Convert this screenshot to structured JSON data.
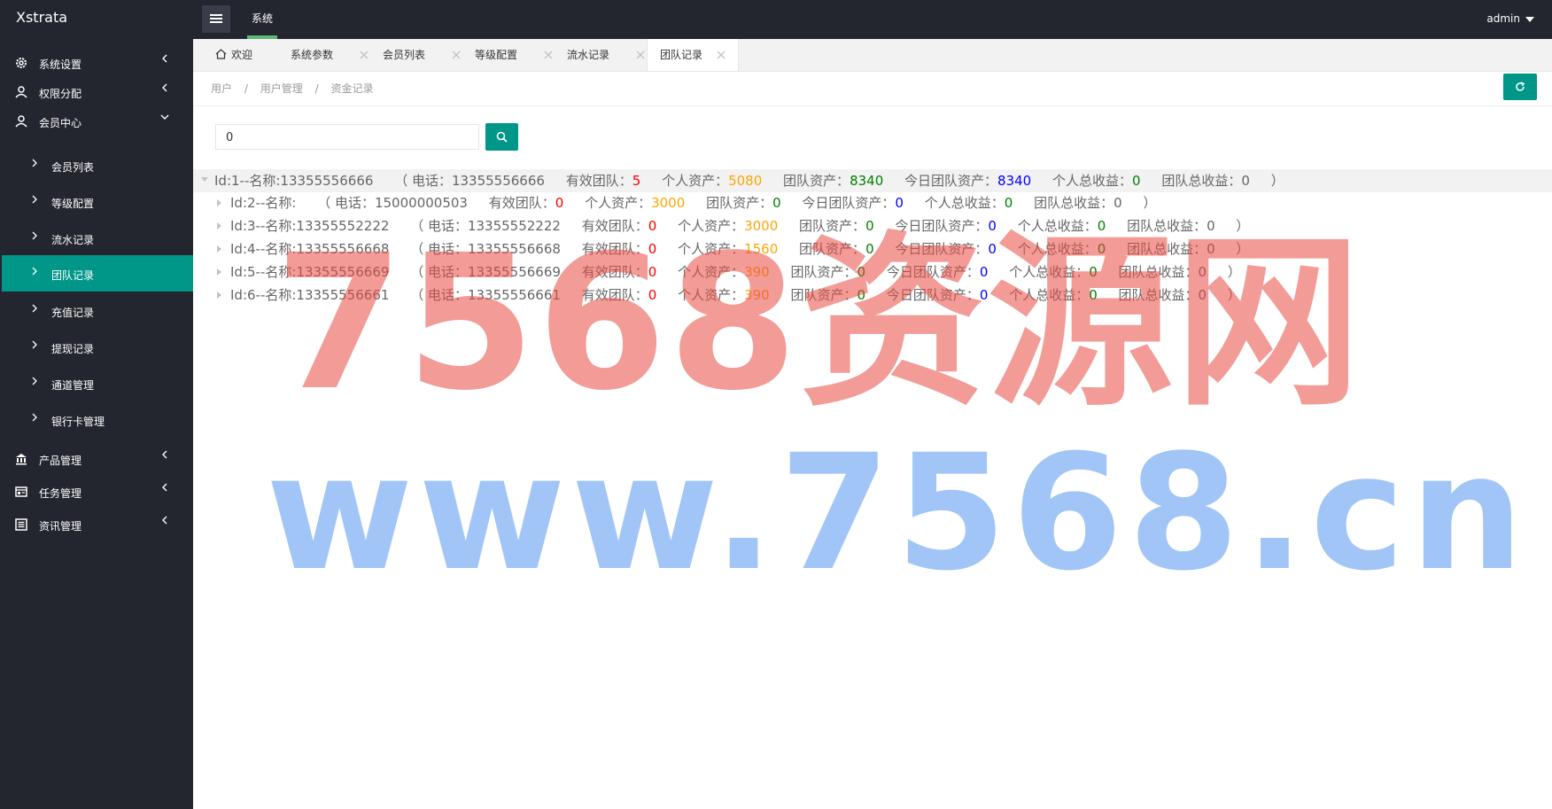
{
  "app": {
    "title": "Xstrata",
    "user": "admin"
  },
  "header": {
    "menu_tab": "系统"
  },
  "sidebar": {
    "items": [
      {
        "label": "系统设置",
        "icon": "gear-icon"
      },
      {
        "label": "权限分配",
        "icon": "user-icon"
      },
      {
        "label": "会员中心",
        "icon": "user-icon"
      },
      {
        "label": "产品管理",
        "icon": "bank-icon"
      },
      {
        "label": "任务管理",
        "icon": "form-icon"
      },
      {
        "label": "资讯管理",
        "icon": "list-icon"
      }
    ],
    "sub_items": [
      {
        "label": "会员列表"
      },
      {
        "label": "等级配置"
      },
      {
        "label": "流水记录"
      },
      {
        "label": "团队记录",
        "active": true
      },
      {
        "label": "充值记录"
      },
      {
        "label": "提现记录"
      },
      {
        "label": "通道管理"
      },
      {
        "label": "银行卡管理"
      }
    ]
  },
  "tabs": [
    {
      "label": "欢迎",
      "icon": "home-icon"
    },
    {
      "label": "系统参数"
    },
    {
      "label": "会员列表"
    },
    {
      "label": "等级配置"
    },
    {
      "label": "流水记录"
    },
    {
      "label": "团队记录",
      "active": true
    }
  ],
  "breadcrumb": [
    "用户",
    "/",
    "用户管理",
    "/",
    "资金记录"
  ],
  "search": {
    "value": "0"
  },
  "tree": [
    {
      "id": "Id:1--名称:13355556666",
      "phone": "（ 电话：13355556666",
      "team_label": "有效团队：",
      "team": "5",
      "asset_label": "个人资产：",
      "asset": "5080",
      "team_asset_label": "团队资产：",
      "team_asset": "8340",
      "today_label": "今日团队资产：",
      "today": "8340",
      "income_label": "个人总收益：",
      "income": "0",
      "team_income_label": "团队总收益：",
      "team_income": "0",
      "close": "）"
    },
    {
      "id": "Id:2--名称:",
      "phone": "（ 电话：15000000503",
      "team_label": "有效团队：",
      "team": "0",
      "asset_label": "个人资产：",
      "asset": "3000",
      "team_asset_label": "团队资产：",
      "team_asset": "0",
      "today_label": "今日团队资产：",
      "today": "0",
      "income_label": "个人总收益：",
      "income": "0",
      "team_income_label": "团队总收益：",
      "team_income": "0",
      "close": "）"
    },
    {
      "id": "Id:3--名称:13355552222",
      "phone": "（ 电话：13355552222",
      "team_label": "有效团队：",
      "team": "0",
      "asset_label": "个人资产：",
      "asset": "3000",
      "team_asset_label": "团队资产：",
      "team_asset": "0",
      "today_label": "今日团队资产：",
      "today": "0",
      "income_label": "个人总收益：",
      "income": "0",
      "team_income_label": "团队总收益：",
      "team_income": "0",
      "close": "）"
    },
    {
      "id": "Id:4--名称:13355556668",
      "phone": "（ 电话：13355556668",
      "team_label": "有效团队：",
      "team": "0",
      "asset_label": "个人资产：",
      "asset": "1560",
      "team_asset_label": "团队资产：",
      "team_asset": "0",
      "today_label": "今日团队资产：",
      "today": "0",
      "income_label": "个人总收益：",
      "income": "0",
      "team_income_label": "团队总收益：",
      "team_income": "0",
      "close": "）"
    },
    {
      "id": "Id:5--名称:13355556669",
      "phone": "（ 电话：13355556669",
      "team_label": "有效团队：",
      "team": "0",
      "asset_label": "个人资产：",
      "asset": "390",
      "team_asset_label": "团队资产：",
      "team_asset": "0",
      "today_label": "今日团队资产：",
      "today": "0",
      "income_label": "个人总收益：",
      "income": "0",
      "team_income_label": "团队总收益：",
      "team_income": "0",
      "close": "）"
    },
    {
      "id": "Id:6--名称:13355556661",
      "phone": "（ 电话：13355556661",
      "team_label": "有效团队：",
      "team": "0",
      "asset_label": "个人资产：",
      "asset": "390",
      "team_asset_label": "团队资产：",
      "team_asset": "0",
      "today_label": "今日团队资产：",
      "today": "0",
      "income_label": "个人总收益：",
      "income": "0",
      "team_income_label": "团队总收益：",
      "team_income": "0",
      "close": "）"
    }
  ],
  "watermark": {
    "line1": "7568资源网",
    "line2": "www.7568.cn"
  }
}
